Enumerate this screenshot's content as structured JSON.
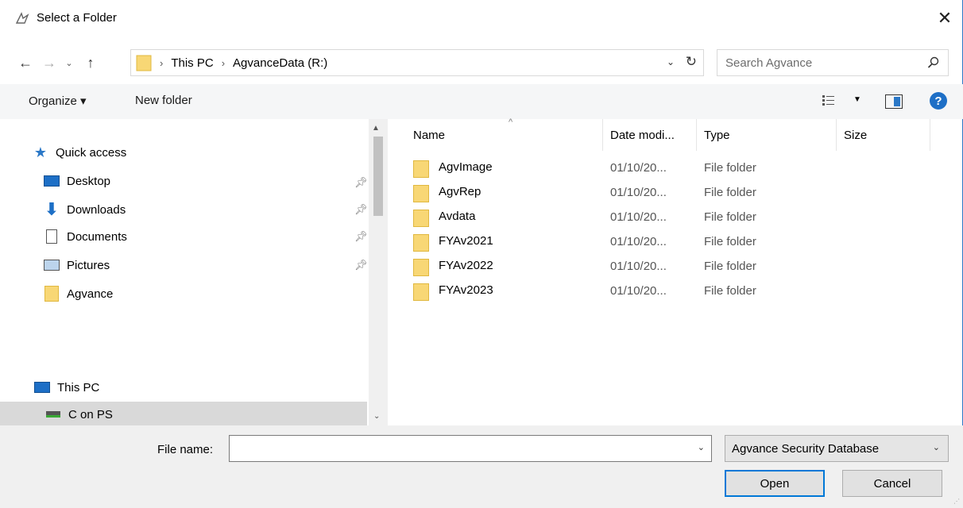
{
  "window": {
    "title": "Select a Folder"
  },
  "nav": {
    "recent_glyph": "⌄"
  },
  "address": {
    "path": [
      {
        "label": "This PC"
      },
      {
        "label": "AgvanceData (R:)"
      }
    ]
  },
  "search": {
    "placeholder": "Search Agvance"
  },
  "toolbar": {
    "organize_label": "Organize ▾",
    "new_folder_label": "New folder",
    "help_label": "?"
  },
  "navpane": {
    "quick_access": "Quick access",
    "items": [
      {
        "label": "Desktop",
        "icon": "desktop-icon",
        "pinned": true
      },
      {
        "label": "Downloads",
        "icon": "download-icon",
        "pinned": true
      },
      {
        "label": "Documents",
        "icon": "documents-icon",
        "pinned": true
      },
      {
        "label": "Pictures",
        "icon": "pictures-icon",
        "pinned": true
      },
      {
        "label": "Agvance",
        "icon": "folder-icon",
        "pinned": false
      }
    ],
    "this_pc": "This PC",
    "drive": "C on PS"
  },
  "filelist": {
    "columns": [
      "Name",
      "Date modi...",
      "Type",
      "Size"
    ],
    "rows": [
      {
        "name": "AgvImage",
        "date": "01/10/20...",
        "type": "File folder"
      },
      {
        "name": "AgvRep",
        "date": "01/10/20...",
        "type": "File folder"
      },
      {
        "name": "Avdata",
        "date": "01/10/20...",
        "type": "File folder"
      },
      {
        "name": "FYAv2021",
        "date": "01/10/20...",
        "type": "File folder"
      },
      {
        "name": "FYAv2022",
        "date": "01/10/20...",
        "type": "File folder"
      },
      {
        "name": "FYAv2023",
        "date": "01/10/20...",
        "type": "File folder"
      }
    ]
  },
  "footer": {
    "file_name_label": "File name:",
    "file_name_value": "",
    "filter_value": "Agvance Security Database",
    "open_label": "Open",
    "cancel_label": "Cancel"
  },
  "colors": {
    "accent": "#0078d7",
    "folder": "#f8d775",
    "selection": "#d9d9d9"
  }
}
